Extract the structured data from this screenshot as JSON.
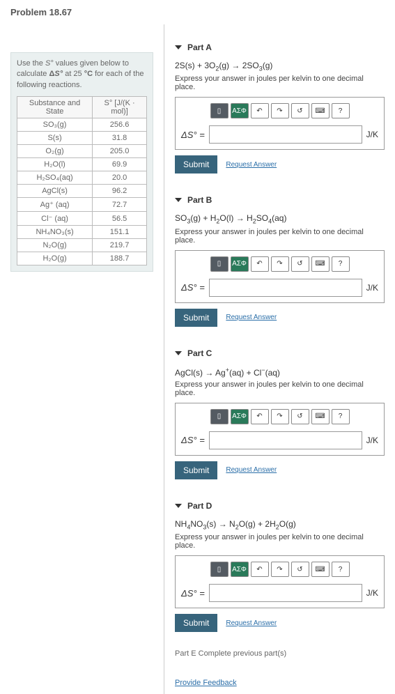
{
  "header": {
    "title": "Problem 18.67"
  },
  "sidebar": {
    "intro_html": "Use the <i>S°</i> values given below to calculate <b>Δ<i>S°</i></b> at 25 <b>°C</b> for each of the following reactions.",
    "table": {
      "headers": [
        "Substance and State",
        "S° [J/(K · mol)]"
      ],
      "rows": [
        [
          "SO₃(g)",
          "256.6"
        ],
        [
          "S(s)",
          "31.8"
        ],
        [
          "O₂(g)",
          "205.0"
        ],
        [
          "H₂O(l)",
          "69.9"
        ],
        [
          "H₂SO₄(aq)",
          "20.0"
        ],
        [
          "AgCl(s)",
          "96.2"
        ],
        [
          "Ag⁺ (aq)",
          "72.7"
        ],
        [
          "Cl⁻ (aq)",
          "56.5"
        ],
        [
          "NH₄NO₃(s)",
          "151.1"
        ],
        [
          "N₂O(g)",
          "219.7"
        ],
        [
          "H₂O(g)",
          "188.7"
        ]
      ]
    }
  },
  "parts": {
    "a": {
      "title": "Part A",
      "reaction_html": "2S(s) + 3O<sub>2</sub>(g) → 2SO<sub>3</sub>(g)",
      "instruction": "Express your answer in joules per kelvin to one decimal place.",
      "label_html": "Δ<i>S°</i> =",
      "unit": "J/K",
      "submit": "Submit",
      "request": "Request Answer"
    },
    "b": {
      "title": "Part B",
      "reaction_html": "SO<sub>3</sub>(g) + H<sub>2</sub>O(l) → H<sub>2</sub>SO<sub>4</sub>(aq)",
      "instruction": "Express your answer in joules per kelvin to one decimal place.",
      "label_html": "Δ<i>S°</i> =",
      "unit": "J/K",
      "submit": "Submit",
      "request": "Request Answer"
    },
    "c": {
      "title": "Part C",
      "reaction_html": "AgCl(s) → Ag<sup>+</sup>(aq) + Cl<sup>−</sup>(aq)",
      "instruction": "Express your answer in joules per kelvin to one decimal place.",
      "label_html": "Δ<i>S°</i> =",
      "unit": "J/K",
      "submit": "Submit",
      "request": "Request Answer"
    },
    "d": {
      "title": "Part D",
      "reaction_html": "NH<sub>4</sub>NO<sub>3</sub>(s) → N<sub>2</sub>O(g) + 2H<sub>2</sub>O(g)",
      "instruction": "Express your answer in joules per kelvin to one decimal place.",
      "label_html": "Δ<i>S°</i> =",
      "unit": "J/K",
      "submit": "Submit",
      "request": "Request Answer"
    },
    "e": {
      "text": "Part E  Complete previous part(s)"
    }
  },
  "toolbar": {
    "t1": "▯",
    "t2": "AΣΦ",
    "undo": "↶",
    "redo": "↷",
    "reset": "↺",
    "keyboard": "⌨",
    "help": "?"
  },
  "feedback": "Provide Feedback"
}
